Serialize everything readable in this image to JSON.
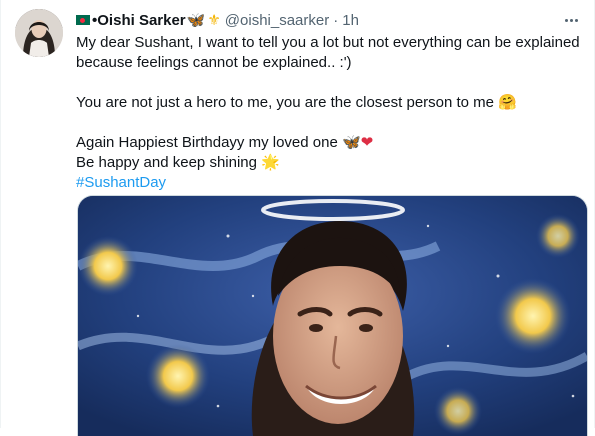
{
  "tweet": {
    "display_name": "Oishi Sarker",
    "name_prefix": "•",
    "handle": "@oishi_saarker",
    "separator": "·",
    "time": "1h",
    "lines": [
      "My dear Sushant, I want to tell you a lot but not everything can be explained",
      "because feelings cannot be explained.. :')",
      "You are not just a hero to me, you are the closest person to me",
      "Again Happiest Birthdayy my loved one",
      "Be happy and keep shining"
    ],
    "hashtag": "#SushantDay",
    "emojis": {
      "name_badge_1": "🦋",
      "name_badge_2": "⚜",
      "hug": "🤗",
      "butterfly": "🦋",
      "heart": "❤",
      "star": "🌟"
    }
  },
  "icons": {
    "flag": "bangladesh-flag-icon",
    "more": "more-horizontal-icon"
  },
  "colors": {
    "text": "#0f1419",
    "muted": "#536471",
    "link": "#1d9bf0"
  }
}
